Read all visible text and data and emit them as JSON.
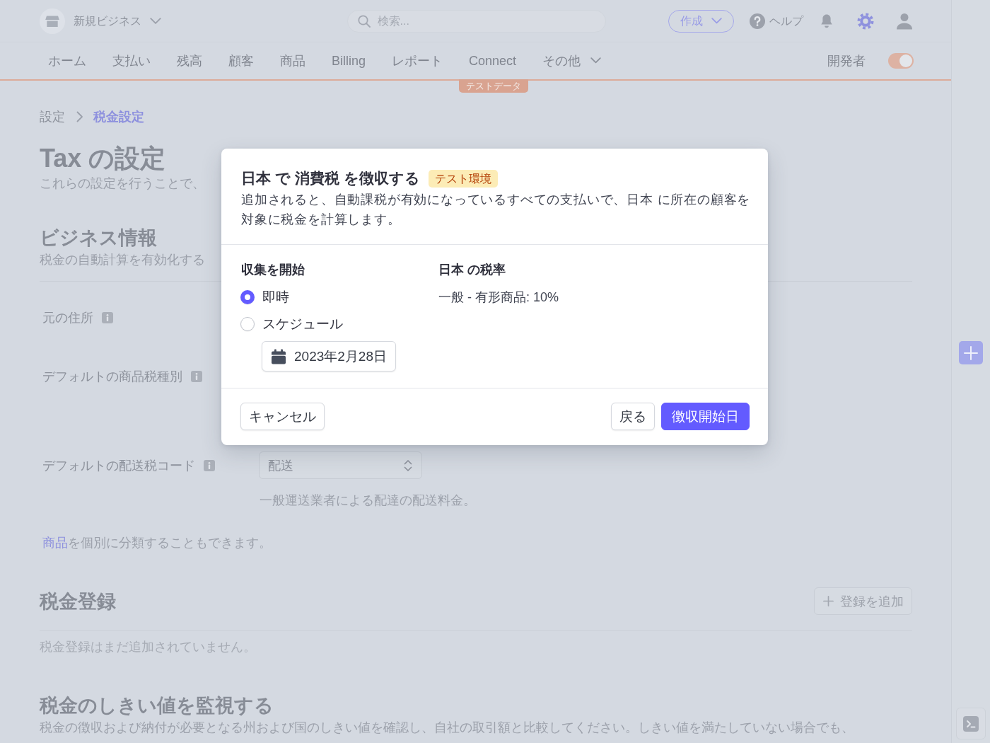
{
  "header": {
    "account": {
      "name": "新規ビジネス"
    },
    "search": {
      "placeholder": "検索..."
    },
    "create_button": "作成",
    "help": "ヘルプ"
  },
  "nav": {
    "items": [
      {
        "label": "ホーム",
        "dropdown": false
      },
      {
        "label": "支払い",
        "dropdown": false
      },
      {
        "label": "残高",
        "dropdown": false
      },
      {
        "label": "顧客",
        "dropdown": false
      },
      {
        "label": "商品",
        "dropdown": false
      },
      {
        "label": "Billing",
        "dropdown": false
      },
      {
        "label": "レポート",
        "dropdown": false
      },
      {
        "label": "Connect",
        "dropdown": false
      },
      {
        "label": "その他",
        "dropdown": true
      }
    ],
    "developer": {
      "label": "開発者",
      "on": true
    }
  },
  "test_badge": "テストデータ",
  "breadcrumb": [
    {
      "label": "設定",
      "selected": false
    },
    {
      "label": "税金設定",
      "selected": true
    }
  ],
  "page": {
    "title": "Tax の設定",
    "subtitle": "これらの設定を行うことで、"
  },
  "business_info": {
    "title": "ビジネス情報",
    "subtitle": "税金の自動計算を有効化する",
    "fields": [
      {
        "label": "元の住所"
      },
      {
        "label": "デフォルトの商品税種別"
      },
      {
        "label": "デフォルトの配送税コード",
        "select": {
          "value": "配送",
          "hint": "一般運送業者による配達の配送料金。"
        }
      }
    ],
    "note": {
      "link": "商品",
      "text": "を個別に分類することもできます。"
    }
  },
  "tax_registrations": {
    "title": "税金登録",
    "add_button": "登録を追加",
    "empty": "税金登録はまだ追加されていません。"
  },
  "thresholds": {
    "title": "税金のしきい値を監視する",
    "description": "税金の徴収および納付が必要となる州および国のしきい値を確認し、自社の取引額と比較してください。しきい値を満たしていない場合でも、"
  },
  "modal": {
    "title": "日本 で 消費税 を徴収する",
    "badge": "テスト環境",
    "description": "追加されると、自動課税が有効になっているすべての支払いで、日本 に所在の顧客を対象に税金を計算します。",
    "start": {
      "label": "収集を開始",
      "options": [
        {
          "label": "即時",
          "selected": true
        },
        {
          "label": "スケジュール",
          "selected": false
        }
      ],
      "date": "2023年2月28日"
    },
    "rate": {
      "label": "日本 の税率",
      "value": "一般 - 有形商品: 10%"
    },
    "buttons": [
      {
        "label": "キャンセル",
        "kind": "cancel"
      },
      {
        "label": "戻る",
        "kind": "back"
      },
      {
        "label": "徴収開始日",
        "kind": "primary"
      }
    ]
  }
}
